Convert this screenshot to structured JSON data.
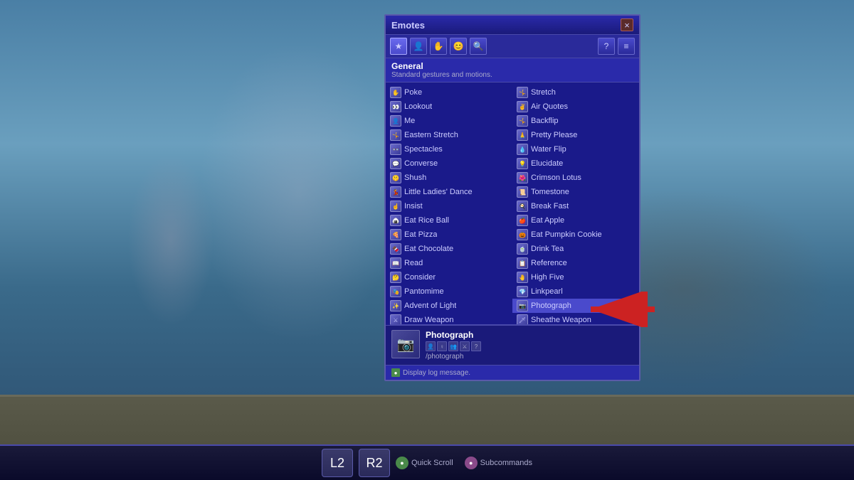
{
  "window": {
    "title": "Emotes",
    "close_label": "×"
  },
  "toolbar": {
    "icons": [
      "★",
      "👤",
      "👆",
      "😊",
      "🔍"
    ],
    "help_icon": "?",
    "settings_icon": "≡"
  },
  "section": {
    "title": "General",
    "subtitle": "Standard gestures and motions."
  },
  "emotes_left": [
    {
      "name": "Poke",
      "icon": "👆"
    },
    {
      "name": "Lookout",
      "icon": "👀"
    },
    {
      "name": "Me",
      "icon": "👤"
    },
    {
      "name": "Eastern Stretch",
      "icon": "🤸"
    },
    {
      "name": "Spectacles",
      "icon": "👓"
    },
    {
      "name": "Converse",
      "icon": "💬"
    },
    {
      "name": "Shush",
      "icon": "🤫"
    },
    {
      "name": "Little Ladies' Dance",
      "icon": "💃"
    },
    {
      "name": "Insist",
      "icon": "☝️"
    },
    {
      "name": "Eat Rice Ball",
      "icon": "🍙"
    },
    {
      "name": "Eat Pizza",
      "icon": "🍕"
    },
    {
      "name": "Eat Chocolate",
      "icon": "🍫"
    },
    {
      "name": "Read",
      "icon": "📖"
    },
    {
      "name": "Consider",
      "icon": "🤔"
    },
    {
      "name": "Pantomime",
      "icon": "🎭"
    },
    {
      "name": "Advent of Light",
      "icon": "✨"
    },
    {
      "name": "Draw Weapon",
      "icon": "⚔️"
    }
  ],
  "emotes_right": [
    {
      "name": "Stretch",
      "icon": "🤸"
    },
    {
      "name": "Air Quotes",
      "icon": "✌️"
    },
    {
      "name": "Backflip",
      "icon": "🤸"
    },
    {
      "name": "Pretty Please",
      "icon": "🙏"
    },
    {
      "name": "Water Flip",
      "icon": "💧"
    },
    {
      "name": "Elucidate",
      "icon": "💡"
    },
    {
      "name": "Crimson Lotus",
      "icon": "🌺"
    },
    {
      "name": "Tomestone",
      "icon": "📜"
    },
    {
      "name": "Break Fast",
      "icon": "🍳"
    },
    {
      "name": "Eat Apple",
      "icon": "🍎"
    },
    {
      "name": "Eat Pumpkin Cookie",
      "icon": "🎃"
    },
    {
      "name": "Drink Tea",
      "icon": "🍵"
    },
    {
      "name": "Reference",
      "icon": "📋"
    },
    {
      "name": "High Five",
      "icon": "🤚"
    },
    {
      "name": "Linkpearl",
      "icon": "💎"
    },
    {
      "name": "Photograph",
      "icon": "📷"
    },
    {
      "name": "Sheathe Weapon",
      "icon": "🗡️"
    }
  ],
  "detail": {
    "name": "Photograph",
    "icon": "📷",
    "command": "/photograph",
    "sub_icons": [
      "👤",
      "♀",
      "👥",
      "🗡️",
      "❓"
    ]
  },
  "footer": {
    "icon": "●",
    "text": "Display log message."
  },
  "taskbar": {
    "quick_scroll_icon": "●",
    "quick_scroll_label": "Quick Scroll",
    "subcommands_icon": "●",
    "subcommands_label": "Subcommands",
    "buttons": [
      "L2",
      "R2"
    ]
  }
}
